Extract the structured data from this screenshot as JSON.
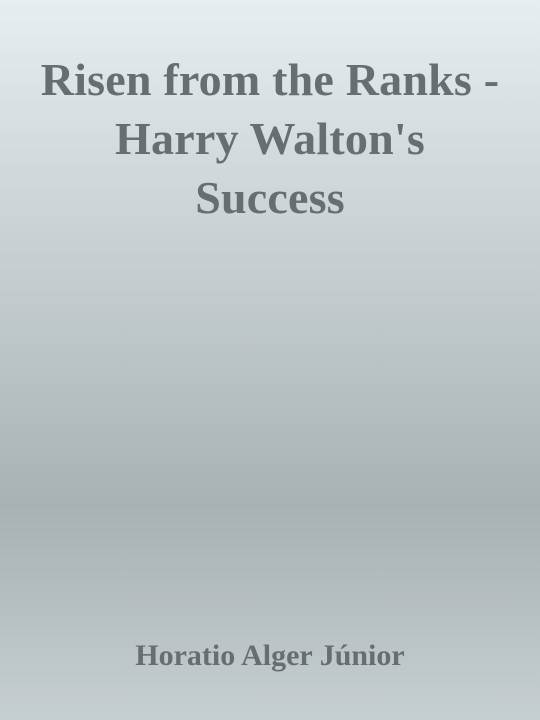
{
  "cover": {
    "title": "Risen from the Ranks - Harry Walton's Success",
    "author": "Horatio Alger Júnior",
    "colors": {
      "text": "#666e71",
      "background_top": "#e6eef2",
      "background_bottom": "#c6cfd2"
    }
  }
}
